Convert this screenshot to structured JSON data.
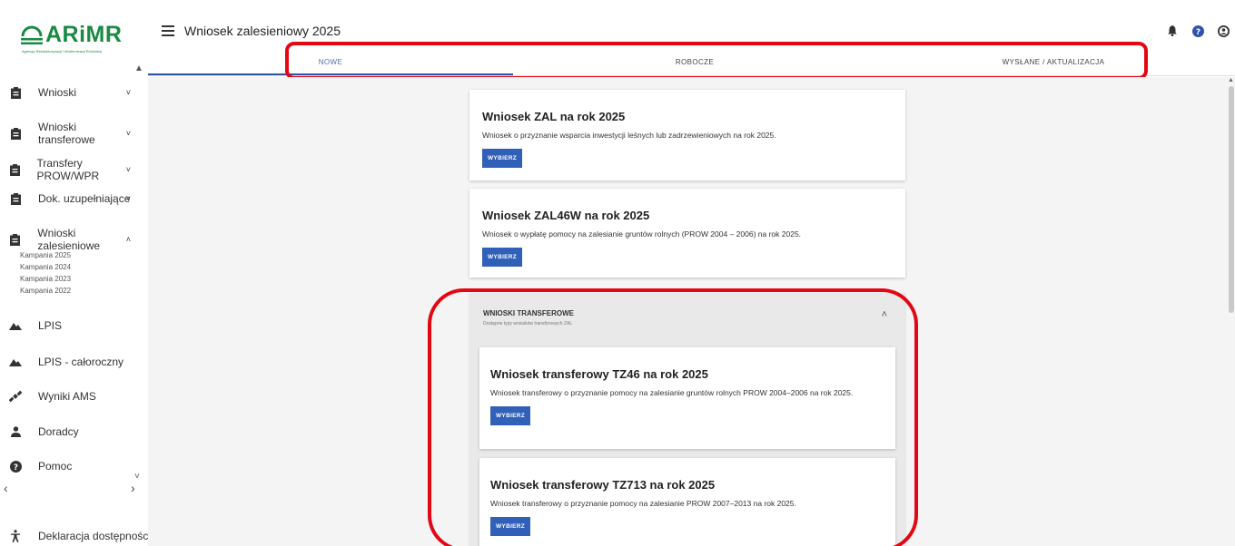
{
  "brand": {
    "logo_text": "ARiMR",
    "logo_subtitle": "Agencja Restrukturyzacji i Modernizacji Rolnictwa",
    "color": "#1a8a43"
  },
  "header": {
    "title": "Wniosek zalesieniowy 2025",
    "icons": [
      "bell-icon",
      "help-icon",
      "user-icon"
    ]
  },
  "tabs": [
    {
      "label": "NOWE",
      "active": true
    },
    {
      "label": "ROBOCZE",
      "active": false
    },
    {
      "label": "WYSŁANE / AKTUALIZACJA",
      "active": false
    }
  ],
  "sidebar": {
    "items": [
      {
        "label": "Wnioski",
        "icon": "clipboard-icon",
        "chevron": "˅"
      },
      {
        "label": "Wnioski transferowe",
        "icon": "clipboard-icon",
        "chevron": "˅"
      },
      {
        "label": "Transfery PROW/WPR",
        "icon": "clipboard-icon",
        "chevron": "˅"
      },
      {
        "label": "Dok. uzupełniające",
        "icon": "clipboard-icon",
        "chevron": "˅"
      },
      {
        "label": "Wnioski zalesieniowe",
        "icon": "clipboard-icon",
        "chevron": "˄"
      },
      {
        "label": "LPIS",
        "icon": "mountain-icon"
      },
      {
        "label": "LPIS - całoroczny",
        "icon": "mountain-icon"
      },
      {
        "label": "Wyniki AMS",
        "icon": "satellite-icon"
      },
      {
        "label": "Doradcy",
        "icon": "person-icon"
      },
      {
        "label": "Pomoc",
        "icon": "help-icon"
      }
    ],
    "sub_items": [
      "Kampania 2025",
      "Kampania 2024",
      "Kampania 2023",
      "Kampania 2022"
    ],
    "footer": {
      "label": "Deklaracja dostępności",
      "icon": "accessibility-icon"
    }
  },
  "cards": [
    {
      "title": "Wniosek ZAL na rok 2025",
      "description": "Wniosek o przyznanie wsparcia inwestycji leśnych lub zadrzewieniowych na rok 2025.",
      "button": "WYBIERZ"
    },
    {
      "title": "Wniosek ZAL46W na rok 2025",
      "description": "Wniosek o wypłatę pomocy na zalesianie gruntów rolnych (PROW 2004 – 2006) na rok 2025.",
      "button": "WYBIERZ"
    }
  ],
  "transfer_panel": {
    "title": "WNIOSKI TRANSFEROWE",
    "subtitle": "Dostępne typy wniosków transferowych ZAL",
    "cards": [
      {
        "title": "Wniosek transferowy TZ46 na rok 2025",
        "description": "Wniosek transferowy o przyznanie pomocy na zalesianie gruntów rolnych PROW 2004–2006 na rok 2025.",
        "button": "WYBIERZ"
      },
      {
        "title": "Wniosek transferowy TZ713 na rok 2025",
        "description": "Wniosek transferowy o przyznanie pomocy na zalesianie PROW 2007–2013 na rok 2025.",
        "button": "WYBIERZ"
      }
    ]
  },
  "colors": {
    "primary_button": "#3060b8",
    "highlight": "#e30613",
    "active_tab": "#2d55a8"
  }
}
